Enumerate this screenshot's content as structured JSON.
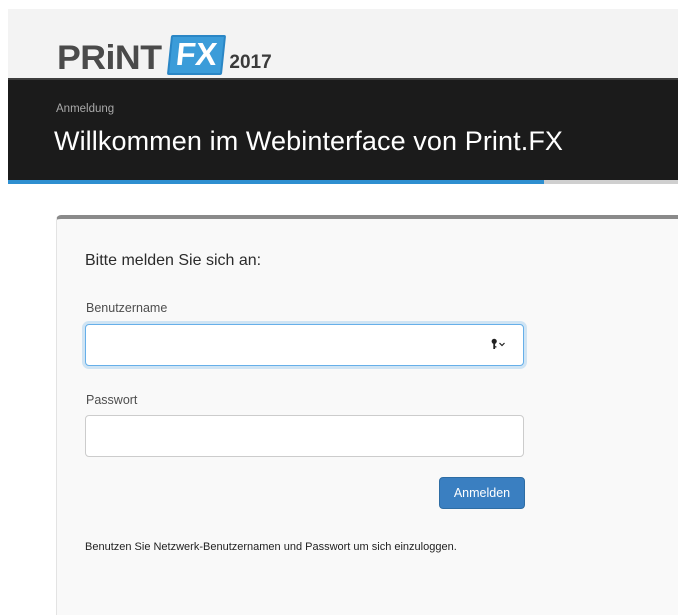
{
  "header": {
    "logo": {
      "brand": "PRiNT",
      "product": "FX",
      "year": "2017"
    },
    "breadcrumb": "Anmeldung",
    "title": "Willkommen im Webinterface von Print.FX",
    "progress_fraction": 0.8
  },
  "login_card": {
    "heading": "Bitte melden Sie sich an:",
    "username": {
      "label": "Benutzername",
      "value": "",
      "placeholder": ""
    },
    "password": {
      "label": "Passwort",
      "value": "",
      "placeholder": ""
    },
    "submit_label": "Anmelden",
    "help_text": "Benutzen Sie Netzwerk-Benutzernamen und Passwort um sich einzuloggen."
  },
  "icons": {
    "password_manager": "key-dropdown-icon"
  },
  "colors": {
    "header_bg": "#1b1b1b",
    "progress": "#2e8fd0",
    "button": "#3a7fc1",
    "focus_ring": "#66afe9"
  }
}
